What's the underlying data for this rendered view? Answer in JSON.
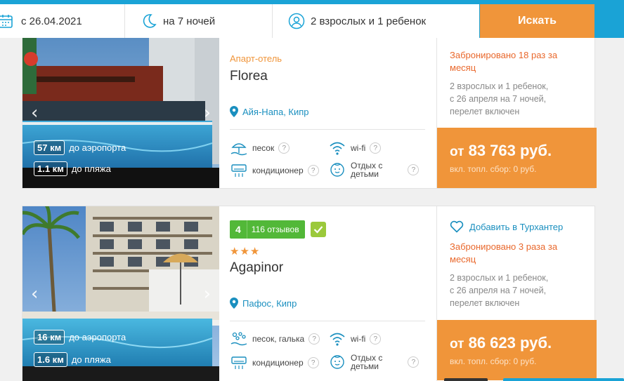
{
  "search": {
    "date": "с 26.04.2021",
    "nights": "на 7 ночей",
    "guests": "2 взрослых и 1 ребенок",
    "button": "Искать",
    "icons": [
      "calendar-icon",
      "moon-icon",
      "person-icon"
    ],
    "accent": "#1aa3d6",
    "button_color": "#f0953a"
  },
  "hotels": [
    {
      "type": "Апарт-отель",
      "name": "Florea",
      "location": "Айя-Напа, Кипр",
      "distances": [
        {
          "km": "57 км",
          "label": "до аэропорта"
        },
        {
          "km": "1.1 км",
          "label": "до пляжа"
        }
      ],
      "amenities": [
        {
          "label": "песок",
          "icon": "beach-icon"
        },
        {
          "label": "wi-fi",
          "icon": "wifi-icon"
        },
        {
          "label": "кондиционер",
          "icon": "ac-icon"
        },
        {
          "label_line1": "Отдых с",
          "label_line2": "детьми",
          "icon": "baby-icon"
        }
      ],
      "booked": "Забронировано 18 раз за месяц",
      "details_line1": "2 взрослых и 1 ребенок,",
      "details_line2": "с 26 апреля на 7 ночей,",
      "details_line3": "перелет включен",
      "price_from": "от",
      "price": "83 763 руб.",
      "fee": "вкл. топл. сбор: 0 руб."
    },
    {
      "rating": "4",
      "reviews": "116 отзывов",
      "stars": 3,
      "stars_text": "★★★",
      "name": "Agapinor",
      "location": "Пафос, Кипр",
      "favorite": "Добавить в Турхантер",
      "distances": [
        {
          "km": "16 км",
          "label": "до аэропорта"
        },
        {
          "km": "1.6 км",
          "label": "до пляжа"
        }
      ],
      "amenities": [
        {
          "label": "песок, галька",
          "icon": "pebbles-icon"
        },
        {
          "label": "wi-fi",
          "icon": "wifi-icon"
        },
        {
          "label": "кондиционер",
          "icon": "ac-icon"
        },
        {
          "label_line1": "Отдых с",
          "label_line2": "детьми",
          "icon": "baby-icon"
        }
      ],
      "booked": "Забронировано 3 раза за месяц",
      "details_line1": "2 взрослых и 1 ребенок,",
      "details_line2": "с 26 апреля на 7 ночей,",
      "details_line3": "перелет включен",
      "price_from": "от",
      "price": "86 623 руб.",
      "fee": "вкл. топл. сбор: 0 руб."
    }
  ],
  "help_glyph": "?"
}
